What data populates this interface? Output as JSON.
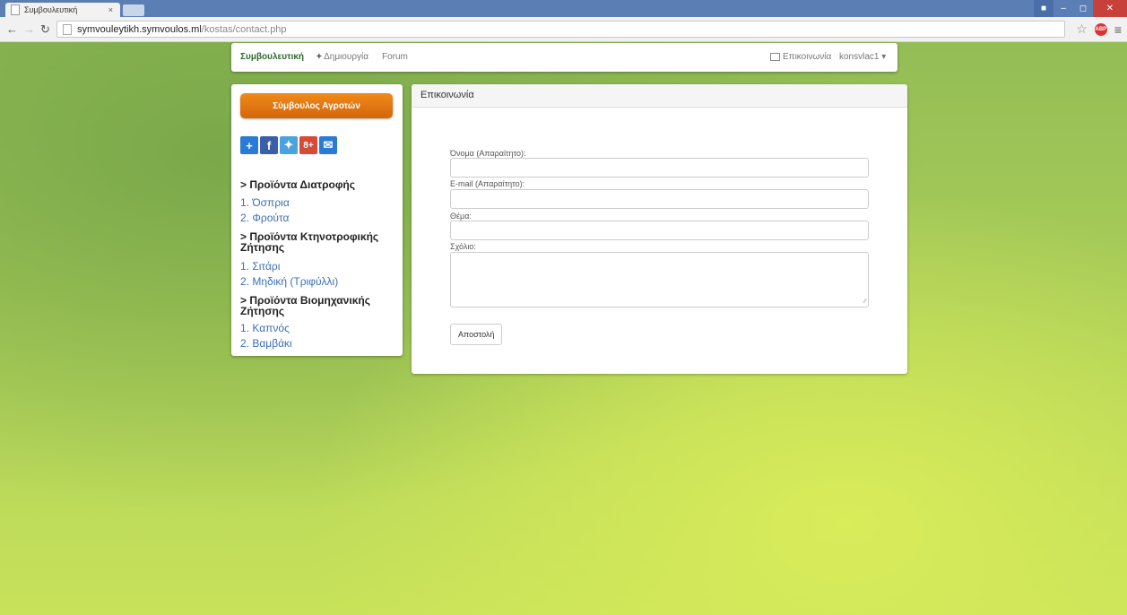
{
  "browser": {
    "tab_title": "Συμβουλευτική",
    "tab_close": "×",
    "url_host": "symvouleytikh.symvoulos.ml",
    "url_path": "/kostas/contact.php"
  },
  "navbar": {
    "brand": "Συμβουλευτική",
    "create": "Δημιουργία",
    "forum": "Forum",
    "contact": "Επικοινωνία",
    "user": "konsvlac1 ▾"
  },
  "sidebar": {
    "advisor_button": "Σύμβουλος Αγροτών",
    "sections": [
      {
        "title": "> Προϊόντα Διατροφής",
        "items": [
          "1. Όσπρια",
          "2. Φρούτα"
        ]
      },
      {
        "title": "> Προϊόντα Κτηνοτροφικής Ζήτησης",
        "items": [
          "1. Σιτάρι",
          "2. Μηδική (Τριφύλλι)"
        ]
      },
      {
        "title": "> Προϊόντα Βιομηχανικής Ζήτησης",
        "items": [
          "1. Καπνός",
          "2. Βαμβάκι"
        ]
      }
    ]
  },
  "contact": {
    "heading": "Επικοινωνία",
    "name_label": "Όνομα (Απαραίτητο):",
    "email_label": "E-mail (Απαραίτητο):",
    "subject_label": "Θέμα:",
    "comment_label": "Σχόλιο:",
    "submit": "Αποστολή"
  }
}
